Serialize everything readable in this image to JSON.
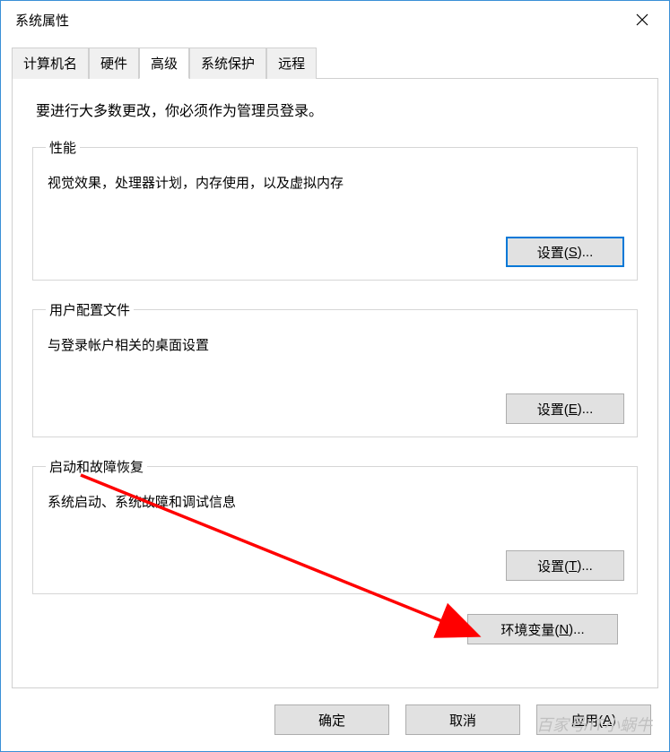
{
  "window": {
    "title": "系统属性"
  },
  "tabs": {
    "items": [
      {
        "label": "计算机名"
      },
      {
        "label": "硬件"
      },
      {
        "label": "高级"
      },
      {
        "label": "系统保护"
      },
      {
        "label": "远程"
      }
    ],
    "active_index": 2
  },
  "panel": {
    "intro": "要进行大多数更改，你必须作为管理员登录。",
    "groups": {
      "performance": {
        "legend": "性能",
        "desc": "视觉效果，处理器计划，内存使用，以及虚拟内存",
        "button_prefix": "设置(",
        "button_hotkey": "S",
        "button_suffix": ")..."
      },
      "user_profile": {
        "legend": "用户配置文件",
        "desc": "与登录帐户相关的桌面设置",
        "button_prefix": "设置(",
        "button_hotkey": "E",
        "button_suffix": ")..."
      },
      "startup": {
        "legend": "启动和故障恢复",
        "desc": "系统启动、系统故障和调试信息",
        "button_prefix": "设置(",
        "button_hotkey": "T",
        "button_suffix": ")..."
      }
    },
    "env_button_prefix": "环境变量(",
    "env_button_hotkey": "N",
    "env_button_suffix": ")..."
  },
  "dialog_buttons": {
    "ok": "确定",
    "cancel": "取消",
    "apply_prefix": "应用(",
    "apply_hotkey": "A",
    "apply_suffix": ")"
  },
  "watermark": "百家号/IT小蜗牛"
}
